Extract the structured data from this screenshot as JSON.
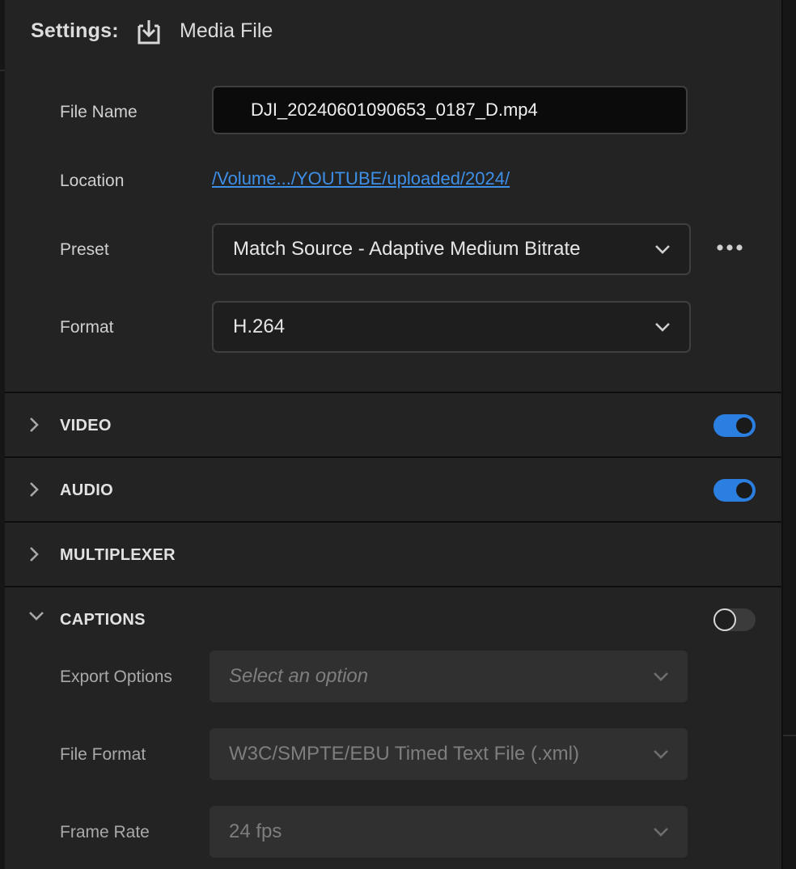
{
  "header": {
    "settings_label": "Settings:",
    "export_icon": "export-download-icon",
    "media_label": "Media File"
  },
  "file_name": {
    "label": "File Name",
    "value": "DJI_20240601090653_0187_D.mp4"
  },
  "location": {
    "label": "Location",
    "link_text": "/Volume.../YOUTUBE/uploaded/2024/"
  },
  "preset": {
    "label": "Preset",
    "value": "Match Source - Adaptive Medium Bitrate",
    "more_icon": "more-horizontal-icon"
  },
  "format": {
    "label": "Format",
    "value": "H.264"
  },
  "sections": [
    {
      "title": "VIDEO",
      "expanded": false,
      "toggle": true,
      "enabled": true
    },
    {
      "title": "AUDIO",
      "expanded": false,
      "toggle": true,
      "enabled": true
    },
    {
      "title": "MULTIPLEXER",
      "expanded": false,
      "toggle": false
    },
    {
      "title": "CAPTIONS",
      "expanded": true,
      "toggle": true,
      "enabled": false
    }
  ],
  "captions": {
    "export_options": {
      "label": "Export Options",
      "placeholder": "Select an option"
    },
    "file_format": {
      "label": "File Format",
      "value": "W3C/SMPTE/EBU Timed Text File (.xml)"
    },
    "frame_rate": {
      "label": "Frame Rate",
      "value": "24 fps"
    }
  },
  "colors": {
    "accent": "#2a7fe0",
    "link": "#3d8fe8",
    "panel_bg": "#232323"
  }
}
